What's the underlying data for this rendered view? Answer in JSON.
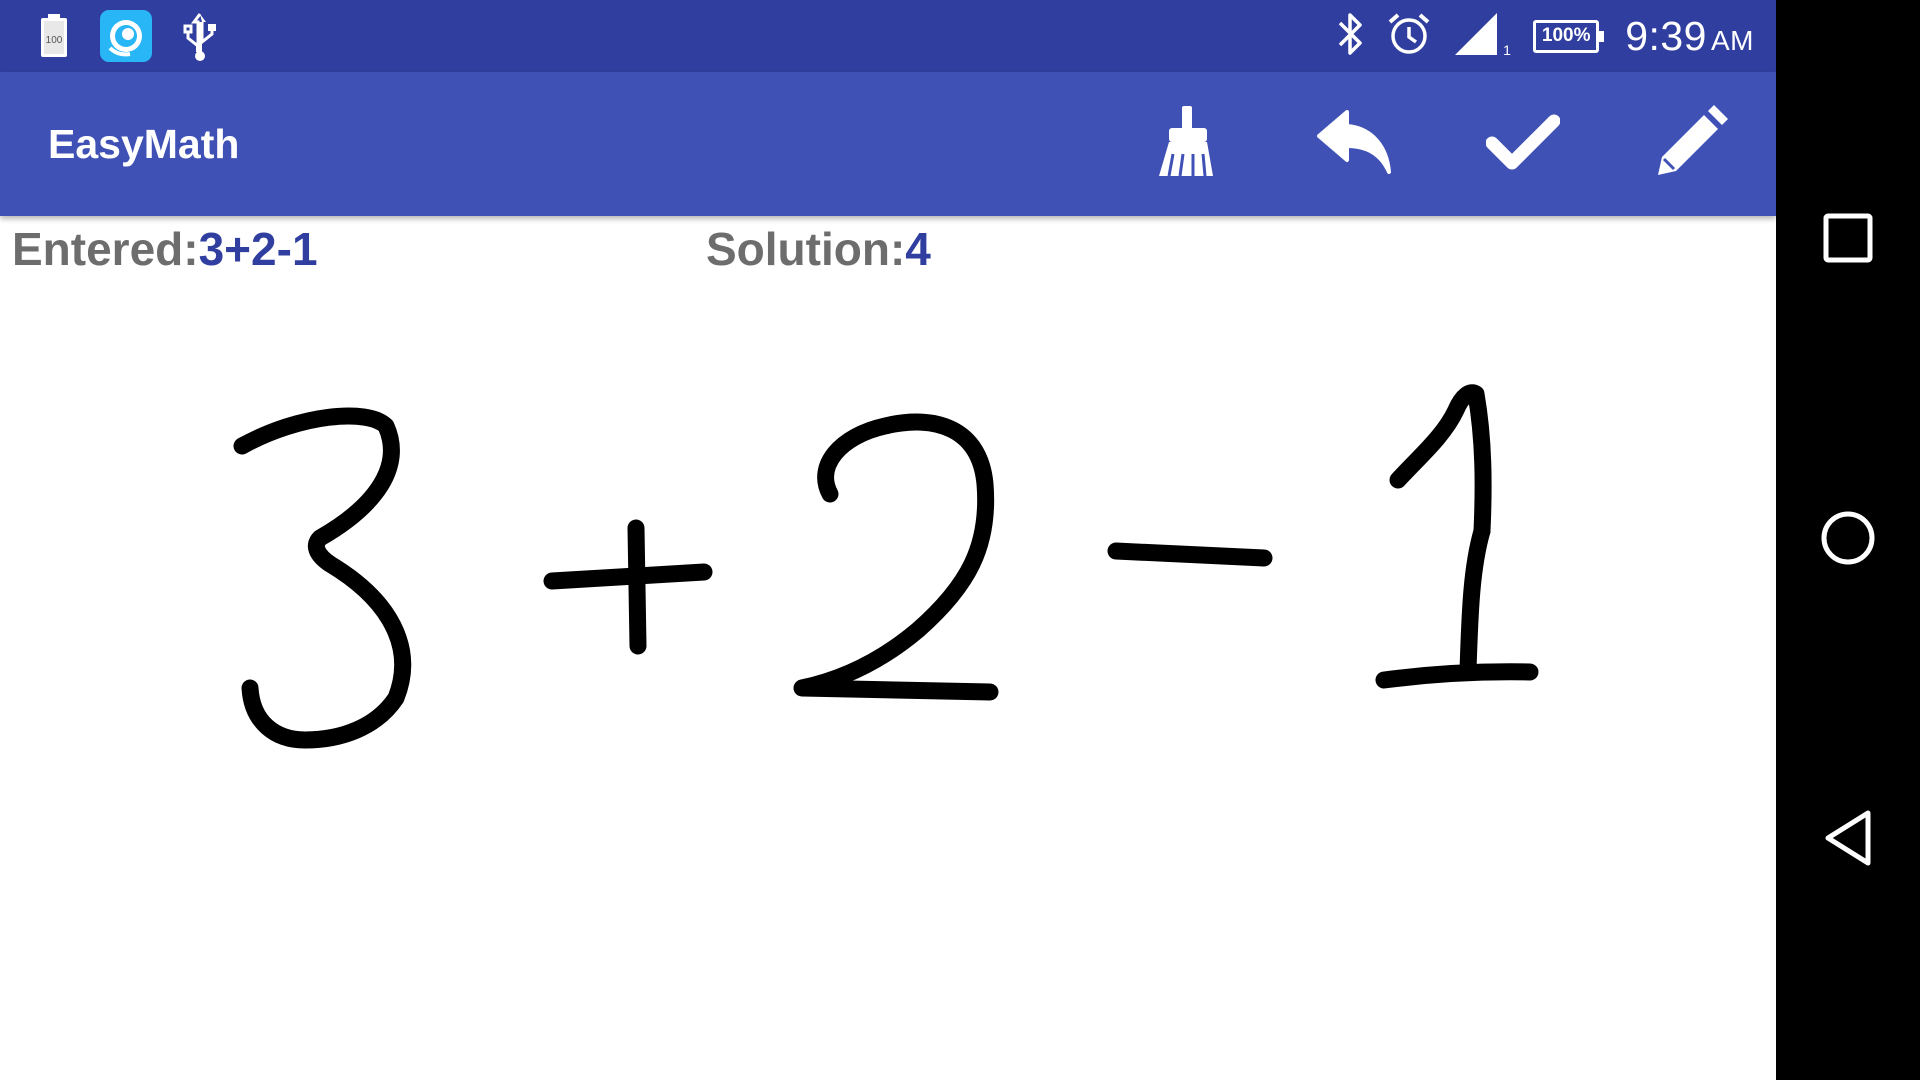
{
  "status_bar": {
    "battery_small_label": "100",
    "battery_percent": "100%",
    "signal_sub": "1",
    "time": "9:39",
    "ampm": "AM"
  },
  "app_bar": {
    "title": "EasyMath",
    "actions": [
      "clear-icon",
      "undo-icon",
      "check-icon",
      "pencil-icon"
    ]
  },
  "result": {
    "entered_label": "Entered:",
    "entered_value": "3+2-1",
    "solution_label": "Solution:",
    "solution_value": "4"
  },
  "canvas": {
    "handwritten_expression": "3+2-1",
    "ink_color": "#000000"
  },
  "nav_bar": {
    "buttons": [
      "recents-icon",
      "home-icon",
      "back-icon"
    ]
  },
  "colors": {
    "primary": "#3f51b5",
    "primary_dark": "#303f9f",
    "label_gray": "#6d6d6d"
  }
}
